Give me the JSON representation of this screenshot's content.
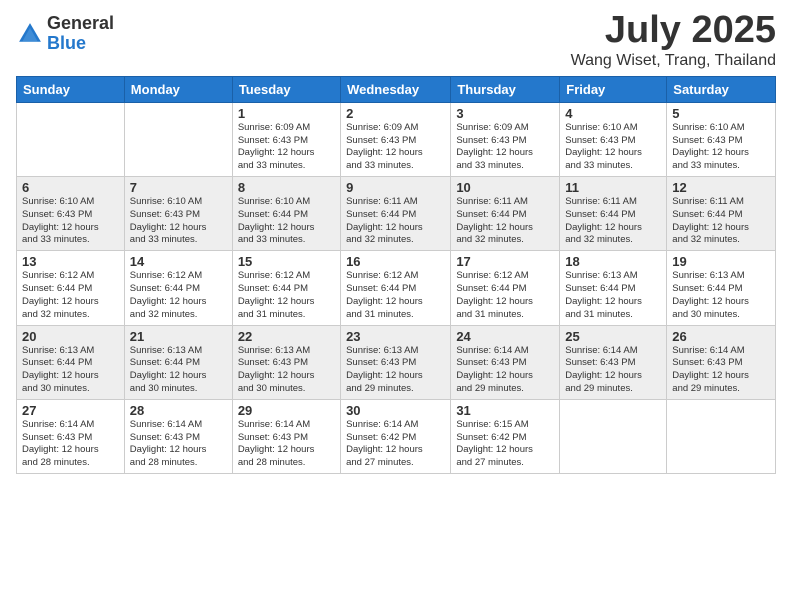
{
  "logo": {
    "general": "General",
    "blue": "Blue"
  },
  "title": "July 2025",
  "location": "Wang Wiset, Trang, Thailand",
  "days_of_week": [
    "Sunday",
    "Monday",
    "Tuesday",
    "Wednesday",
    "Thursday",
    "Friday",
    "Saturday"
  ],
  "weeks": [
    [
      {
        "day": "",
        "info": ""
      },
      {
        "day": "",
        "info": ""
      },
      {
        "day": "1",
        "info": "Sunrise: 6:09 AM\nSunset: 6:43 PM\nDaylight: 12 hours\nand 33 minutes."
      },
      {
        "day": "2",
        "info": "Sunrise: 6:09 AM\nSunset: 6:43 PM\nDaylight: 12 hours\nand 33 minutes."
      },
      {
        "day": "3",
        "info": "Sunrise: 6:09 AM\nSunset: 6:43 PM\nDaylight: 12 hours\nand 33 minutes."
      },
      {
        "day": "4",
        "info": "Sunrise: 6:10 AM\nSunset: 6:43 PM\nDaylight: 12 hours\nand 33 minutes."
      },
      {
        "day": "5",
        "info": "Sunrise: 6:10 AM\nSunset: 6:43 PM\nDaylight: 12 hours\nand 33 minutes."
      }
    ],
    [
      {
        "day": "6",
        "info": "Sunrise: 6:10 AM\nSunset: 6:43 PM\nDaylight: 12 hours\nand 33 minutes."
      },
      {
        "day": "7",
        "info": "Sunrise: 6:10 AM\nSunset: 6:43 PM\nDaylight: 12 hours\nand 33 minutes."
      },
      {
        "day": "8",
        "info": "Sunrise: 6:10 AM\nSunset: 6:44 PM\nDaylight: 12 hours\nand 33 minutes."
      },
      {
        "day": "9",
        "info": "Sunrise: 6:11 AM\nSunset: 6:44 PM\nDaylight: 12 hours\nand 32 minutes."
      },
      {
        "day": "10",
        "info": "Sunrise: 6:11 AM\nSunset: 6:44 PM\nDaylight: 12 hours\nand 32 minutes."
      },
      {
        "day": "11",
        "info": "Sunrise: 6:11 AM\nSunset: 6:44 PM\nDaylight: 12 hours\nand 32 minutes."
      },
      {
        "day": "12",
        "info": "Sunrise: 6:11 AM\nSunset: 6:44 PM\nDaylight: 12 hours\nand 32 minutes."
      }
    ],
    [
      {
        "day": "13",
        "info": "Sunrise: 6:12 AM\nSunset: 6:44 PM\nDaylight: 12 hours\nand 32 minutes."
      },
      {
        "day": "14",
        "info": "Sunrise: 6:12 AM\nSunset: 6:44 PM\nDaylight: 12 hours\nand 32 minutes."
      },
      {
        "day": "15",
        "info": "Sunrise: 6:12 AM\nSunset: 6:44 PM\nDaylight: 12 hours\nand 31 minutes."
      },
      {
        "day": "16",
        "info": "Sunrise: 6:12 AM\nSunset: 6:44 PM\nDaylight: 12 hours\nand 31 minutes."
      },
      {
        "day": "17",
        "info": "Sunrise: 6:12 AM\nSunset: 6:44 PM\nDaylight: 12 hours\nand 31 minutes."
      },
      {
        "day": "18",
        "info": "Sunrise: 6:13 AM\nSunset: 6:44 PM\nDaylight: 12 hours\nand 31 minutes."
      },
      {
        "day": "19",
        "info": "Sunrise: 6:13 AM\nSunset: 6:44 PM\nDaylight: 12 hours\nand 30 minutes."
      }
    ],
    [
      {
        "day": "20",
        "info": "Sunrise: 6:13 AM\nSunset: 6:44 PM\nDaylight: 12 hours\nand 30 minutes."
      },
      {
        "day": "21",
        "info": "Sunrise: 6:13 AM\nSunset: 6:44 PM\nDaylight: 12 hours\nand 30 minutes."
      },
      {
        "day": "22",
        "info": "Sunrise: 6:13 AM\nSunset: 6:43 PM\nDaylight: 12 hours\nand 30 minutes."
      },
      {
        "day": "23",
        "info": "Sunrise: 6:13 AM\nSunset: 6:43 PM\nDaylight: 12 hours\nand 29 minutes."
      },
      {
        "day": "24",
        "info": "Sunrise: 6:14 AM\nSunset: 6:43 PM\nDaylight: 12 hours\nand 29 minutes."
      },
      {
        "day": "25",
        "info": "Sunrise: 6:14 AM\nSunset: 6:43 PM\nDaylight: 12 hours\nand 29 minutes."
      },
      {
        "day": "26",
        "info": "Sunrise: 6:14 AM\nSunset: 6:43 PM\nDaylight: 12 hours\nand 29 minutes."
      }
    ],
    [
      {
        "day": "27",
        "info": "Sunrise: 6:14 AM\nSunset: 6:43 PM\nDaylight: 12 hours\nand 28 minutes."
      },
      {
        "day": "28",
        "info": "Sunrise: 6:14 AM\nSunset: 6:43 PM\nDaylight: 12 hours\nand 28 minutes."
      },
      {
        "day": "29",
        "info": "Sunrise: 6:14 AM\nSunset: 6:43 PM\nDaylight: 12 hours\nand 28 minutes."
      },
      {
        "day": "30",
        "info": "Sunrise: 6:14 AM\nSunset: 6:42 PM\nDaylight: 12 hours\nand 27 minutes."
      },
      {
        "day": "31",
        "info": "Sunrise: 6:15 AM\nSunset: 6:42 PM\nDaylight: 12 hours\nand 27 minutes."
      },
      {
        "day": "",
        "info": ""
      },
      {
        "day": "",
        "info": ""
      }
    ]
  ]
}
